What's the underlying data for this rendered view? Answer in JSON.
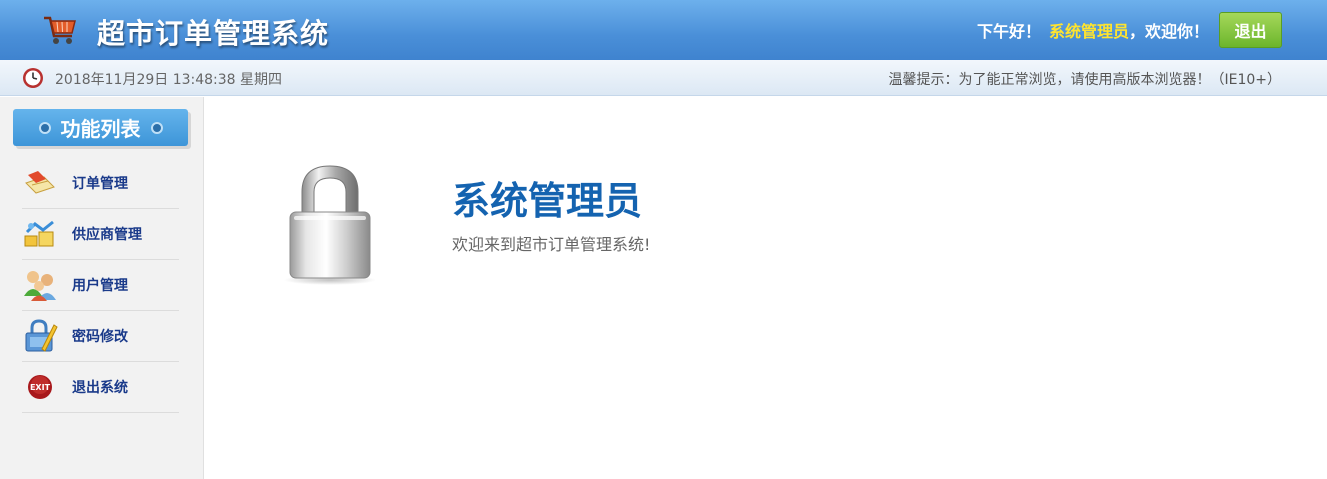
{
  "header": {
    "title": "超市订单管理系统",
    "greeting": "下午好！",
    "username": "系统管理员",
    "greeting_suffix": "，欢迎你！",
    "logout_label": "退出",
    "cart_icon": "shopping-cart-icon"
  },
  "subbar": {
    "datetime": "2018年11月29日 13:48:38 星期四",
    "tip": "温馨提示：为了能正常浏览，请使用高版本浏览器！（IE10+）",
    "clock_icon": "clock-icon"
  },
  "sidebar": {
    "title": "功能列表",
    "items": [
      {
        "label": "订单管理",
        "icon": "order-icon"
      },
      {
        "label": "供应商管理",
        "icon": "supplier-icon"
      },
      {
        "label": "用户管理",
        "icon": "users-icon"
      },
      {
        "label": "密码修改",
        "icon": "password-lock-icon"
      },
      {
        "label": "退出系统",
        "icon": "exit-icon"
      }
    ]
  },
  "main": {
    "welcome_title": "系统管理员",
    "welcome_sub": "欢迎来到超市订单管理系统!",
    "lock_icon": "padlock-icon"
  },
  "colors": {
    "header_blue": "#4a8fd8",
    "username_yellow": "#ffe42e",
    "logout_green": "#7cc23a",
    "title_blue": "#1463b0",
    "menu_text": "#1a3a8a"
  }
}
